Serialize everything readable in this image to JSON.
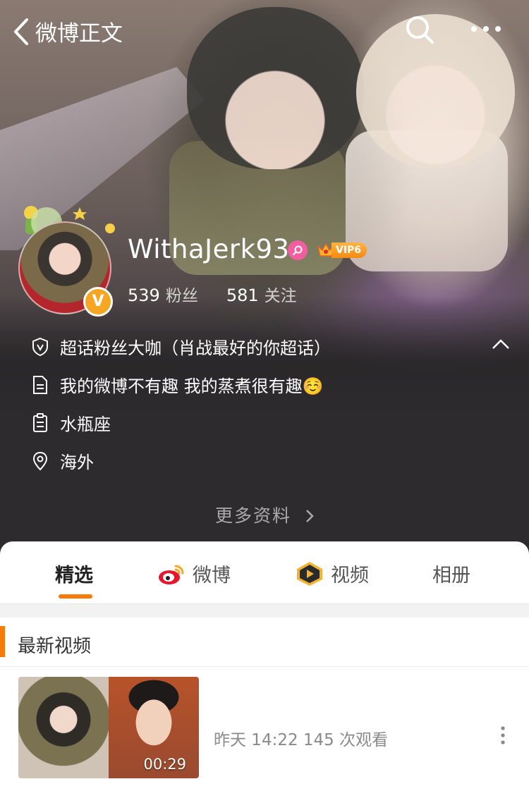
{
  "header": {
    "back_title": "微博正文"
  },
  "profile": {
    "username": "WithaJerk93",
    "vip_label": "VIP6",
    "verified_mark": "V",
    "stats": [
      {
        "value": "539",
        "label": "粉丝"
      },
      {
        "value": "581",
        "label": "关注"
      }
    ],
    "info": [
      {
        "icon": "shield-v-icon",
        "text": "超话粉丝大咖（肖战最好的你超话）"
      },
      {
        "icon": "document-icon",
        "text": "我的微博不有趣 我的蒸煮很有趣☺️"
      },
      {
        "icon": "clipboard-icon",
        "text": "水瓶座"
      },
      {
        "icon": "location-pin-icon",
        "text": "海外"
      }
    ],
    "more_info": "更多资料"
  },
  "tabs": [
    {
      "label": "精选",
      "active": true
    },
    {
      "label": "微博",
      "icon": "weibo-logo-icon"
    },
    {
      "label": "视频",
      "icon": "video-play-icon"
    },
    {
      "label": "相册"
    }
  ],
  "section": {
    "title": "最新视频"
  },
  "video": {
    "duration": "00:29",
    "meta": "昨天 14:22  145 次观看"
  },
  "colors": {
    "accent": "#f77b0a",
    "vip_orange": "#f58a14",
    "super_pink": "#f25e9f",
    "verified_gold": "#f6a623"
  }
}
